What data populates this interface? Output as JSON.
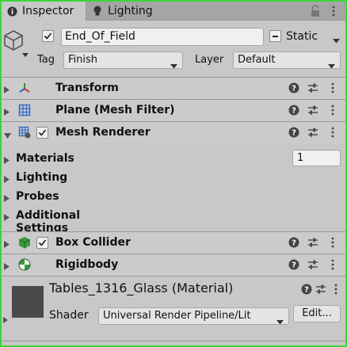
{
  "tabs": [
    {
      "label": "Inspector",
      "icon": "info-icon"
    },
    {
      "label": "Lighting",
      "icon": "lightbulb-icon"
    }
  ],
  "header": {
    "object_name": "End_Of_Field",
    "active_checked": true,
    "static_label": "Static",
    "tag_label": "Tag",
    "tag_value": "Finish",
    "layer_label": "Layer",
    "layer_value": "Default"
  },
  "components": [
    {
      "title": "Transform",
      "icon": "transform-icon",
      "has_checkbox": false,
      "expanded": false
    },
    {
      "title": "Plane (Mesh Filter)",
      "icon": "mesh-filter-icon",
      "has_checkbox": false,
      "expanded": false
    },
    {
      "title": "Mesh Renderer",
      "icon": "mesh-renderer-icon",
      "has_checkbox": true,
      "expanded": true
    },
    {
      "title": "Box Collider",
      "icon": "box-collider-icon",
      "has_checkbox": true,
      "expanded": false
    },
    {
      "title": "Rigidbody",
      "icon": "rigidbody-icon",
      "has_checkbox": false,
      "expanded": false
    }
  ],
  "mesh_renderer": {
    "properties": [
      "Materials",
      "Lighting",
      "Probes",
      "Additional Settings"
    ],
    "materials_size": "1"
  },
  "material": {
    "title": "Tables_1316_Glass (Material)",
    "shader_label": "Shader",
    "shader_value": "Universal Render Pipeline/Lit",
    "edit_label": "Edit..."
  },
  "colors": {
    "frame_border": "#39d639",
    "panel_bg": "#c8c8c8",
    "swatch": "#4a4a4a"
  }
}
